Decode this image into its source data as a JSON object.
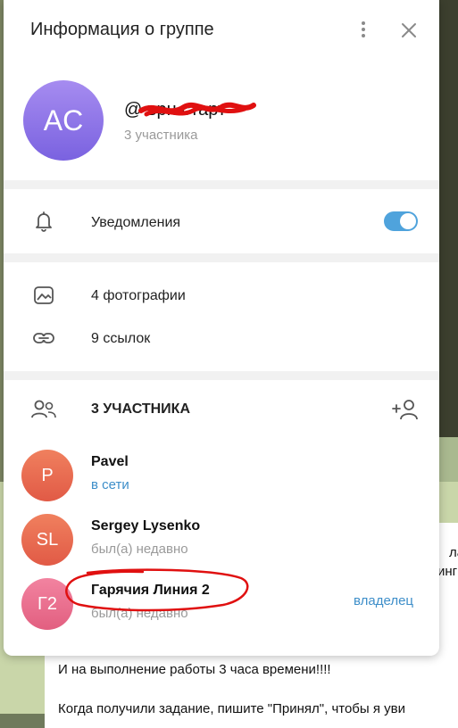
{
  "colors": {
    "accent": "#4fa3dc",
    "online": "#3d8ec9",
    "avatar_group": "#8a72e8",
    "avatar_p": "#e9674f",
    "avatar_sl": "#e9674f",
    "avatar_g2": "#ea6f8c",
    "annotation_red": "#e01010"
  },
  "background_chat": {
    "line1": "И на выполнение работы 3 часа времени!!!!",
    "line2": "Когда получили задание, пишите \"Принял\", чтобы я уви",
    "frag_a": "лад",
    "frag_b": "инг"
  },
  "modal": {
    "title": "Информация о группе",
    "menu_icon": "kebab-menu-icon",
    "close_icon": "close-icon",
    "group": {
      "avatar_initials": "AC",
      "name": "@                врн старт",
      "subtitle": "3 участника"
    },
    "notifications": {
      "icon": "bell-icon",
      "label": "Уведомления",
      "enabled": true
    },
    "media": [
      {
        "icon": "photo-icon",
        "label": "4 фотографии"
      },
      {
        "icon": "link-icon",
        "label": "9 ссылок"
      }
    ],
    "members": {
      "icon": "people-icon",
      "title": "3 УЧАСТНИКА",
      "add_icon": "add-user-icon",
      "list": [
        {
          "initials": "P",
          "name": "Pavel",
          "status": "в сети",
          "online": true,
          "role": ""
        },
        {
          "initials": "SL",
          "name": "Sergey Lysenko",
          "status": "был(а) недавно",
          "online": false,
          "role": ""
        },
        {
          "initials": "Г2",
          "name": "Гарячия Линия 2",
          "status": "был(а) недавно",
          "online": false,
          "role": "владелец"
        }
      ]
    }
  }
}
